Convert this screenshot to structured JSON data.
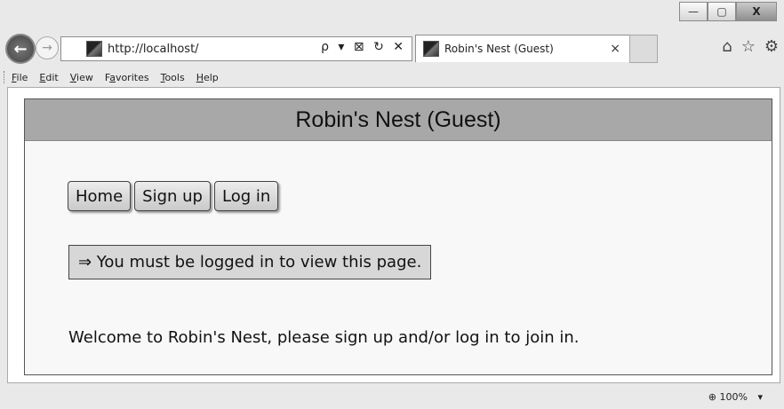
{
  "browser": {
    "window_buttons": {
      "minimize": "—",
      "maximize": "▢",
      "close": "X"
    },
    "nav": {
      "back_icon": "arrow-left",
      "forward_icon": "arrow-right"
    },
    "address": {
      "url": "http://localhost/",
      "tools": "ρ ▾ ⊠ ↻ ✕"
    },
    "tab": {
      "title": "Robin's Nest (Guest)",
      "close": "×"
    },
    "right_icons": {
      "home": "⌂",
      "favorites": "☆",
      "settings": "⚙"
    },
    "menu": {
      "file": {
        "key": "F",
        "rest": "ile"
      },
      "edit": {
        "key": "E",
        "rest": "dit"
      },
      "view": {
        "key": "V",
        "rest": "iew"
      },
      "favorites": {
        "pre": "F",
        "key": "a",
        "rest": "vorites"
      },
      "tools": {
        "key": "T",
        "rest": "ools"
      },
      "help": {
        "key": "H",
        "rest": "elp"
      }
    },
    "status": {
      "zoom": "100%",
      "zoom_arrow": "▾"
    }
  },
  "page": {
    "title": "Robin's Nest (Guest)",
    "buttons": {
      "home": "Home",
      "signup": "Sign up",
      "login": "Log in"
    },
    "notice": "⇒ You must be logged in to view this page.",
    "welcome": "Welcome to Robin's Nest, please sign up and/or log in to join in."
  }
}
